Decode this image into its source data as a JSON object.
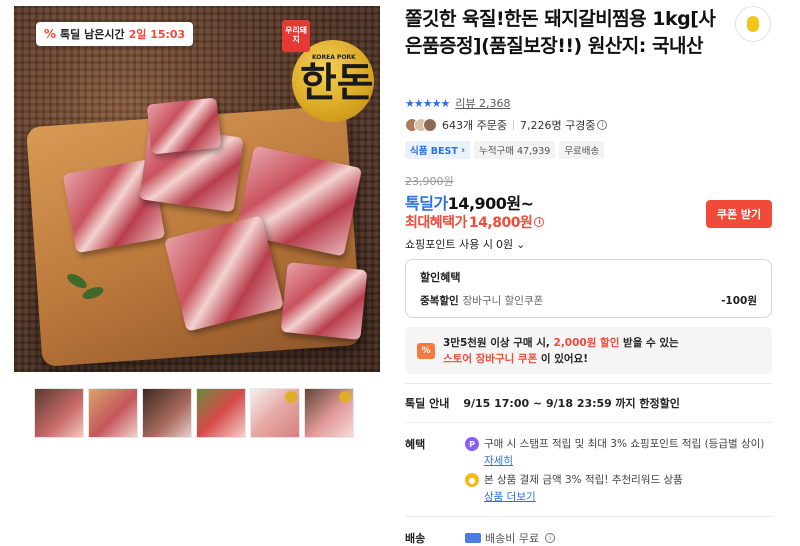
{
  "main_image": {
    "timer_badge": {
      "icon": "percent-icon",
      "label": "톡딜 남은시간",
      "remaining": "2일 15:03"
    },
    "logo": {
      "stamp": "우리돼지",
      "brand_text": "한돈",
      "sub": "KOREA PORK"
    }
  },
  "thumbnails": [
    {
      "alt": "thumbnail-1",
      "color": "#8a4b3a"
    },
    {
      "alt": "thumbnail-2",
      "color": "#b86a3c"
    },
    {
      "alt": "thumbnail-3",
      "color": "#6b4a34"
    },
    {
      "alt": "thumbnail-4",
      "color": "#c94a4a"
    },
    {
      "alt": "thumbnail-5",
      "color": "#e6a9a4"
    },
    {
      "alt": "thumbnail-6",
      "color": "#d87f7f"
    }
  ],
  "product": {
    "title": "쫄깃한 육질!한돈 돼지갈비찜용 1kg[사은품증정](품질보장!!) 원산지: 국내산",
    "rating_stars": "★★★★★",
    "review_link": "리뷰 2,368",
    "orders": "643개 주문중",
    "subscribers": "7,226명 구경중",
    "tags": [
      "식품 BEST",
      "누적구매 47,939",
      "무료배송"
    ],
    "original_price": "23,900원",
    "sale_label": "톡딜가",
    "sale_price": "14,900원~",
    "max_benefit_label": "최대혜택가",
    "max_benefit_price": "14,800원",
    "coupon_button": "쿠폰 받기",
    "shopping_point": "쇼핑포인트 사용 시",
    "shopping_point_value": "0원"
  },
  "discount": {
    "header": "할인혜택",
    "row_label": "중복할인",
    "row_detail": "장바구니 할인쿠폰",
    "row_amount": "-100원"
  },
  "coupon_banner": {
    "line1_a": "3만5천원 이상 구매 시, ",
    "line1_b": "2,000원 할인",
    "line1_c": " 받을 수 있는",
    "line2_a": "스토어 장바구니 쿠폰",
    "line2_b": "이 있어요!"
  },
  "flash_deal": {
    "label": "톡딜 안내",
    "period": "9/15 17:00 ~ 9/18 23:59",
    "suffix": "까지 한정할인"
  },
  "benefits": {
    "label": "혜택",
    "item1": "구매 시 스탬프 적립 및 최대 3% 쇼핑포인트 적립 (등급별 상이)",
    "item1_link": "자세히",
    "item2": "본 상품 결제 금액 3% 적립! 추천리워드 상품",
    "item2_link": "상품 더보기"
  },
  "shipping": {
    "label": "배송",
    "value": "배송비 무료"
  },
  "colors": {
    "accent_blue": "#2f6fe4",
    "accent_red": "#f04b3a"
  }
}
